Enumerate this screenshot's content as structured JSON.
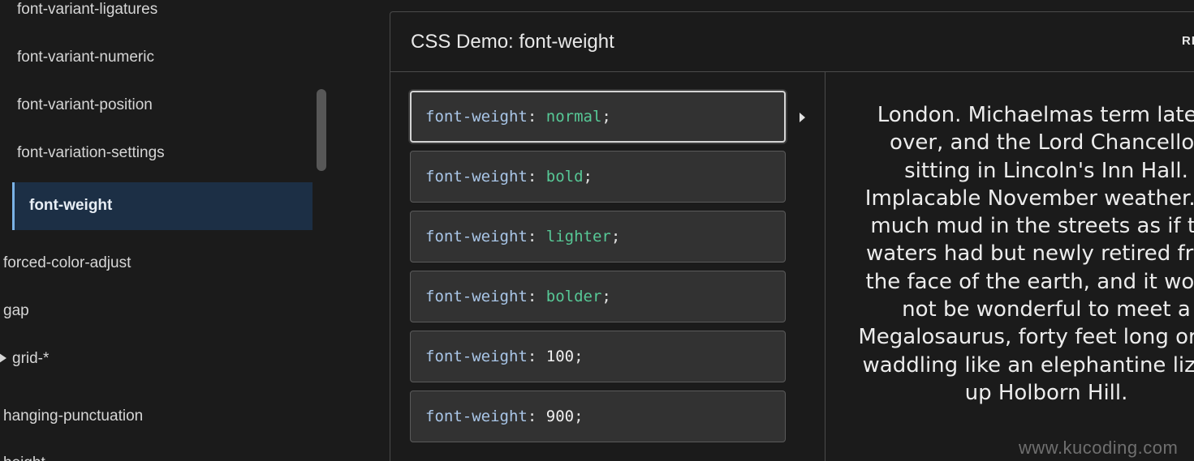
{
  "sidebar": {
    "items": [
      {
        "label": "font-variant-ligatures"
      },
      {
        "label": "font-variant-numeric"
      },
      {
        "label": "font-variant-position"
      },
      {
        "label": "font-variation-settings"
      },
      {
        "label": "font-weight"
      },
      {
        "label": "forced-color-adjust"
      },
      {
        "label": "gap"
      },
      {
        "label": "grid-*"
      },
      {
        "label": "hanging-punctuation"
      },
      {
        "label": "height"
      }
    ]
  },
  "demo": {
    "title": "CSS Demo: font-weight",
    "reset_label": "RESET",
    "options": [
      {
        "property": "font-weight",
        "colon": ":",
        "value": "normal",
        "semicolon": ";"
      },
      {
        "property": "font-weight",
        "colon": ":",
        "value": "bold",
        "semicolon": ";"
      },
      {
        "property": "font-weight",
        "colon": ":",
        "value": "lighter",
        "semicolon": ";"
      },
      {
        "property": "font-weight",
        "colon": ":",
        "value": "bolder",
        "semicolon": ";"
      },
      {
        "property": "font-weight",
        "colon": ":",
        "value": "100",
        "semicolon": ";"
      },
      {
        "property": "font-weight",
        "colon": ":",
        "value": "900",
        "semicolon": ";"
      }
    ],
    "output_lines": [
      "London. Michaelmas term lately",
      "over, and the Lord Chancellor",
      "sitting in Lincoln's Inn Hall.",
      "Implacable November weather. As",
      "much mud in the streets as if the",
      "waters had but newly retired from",
      "the face of the earth, and it would",
      "not be wonderful to meet a",
      "Megalosaurus, forty feet long or so,",
      "waddling like an elephantine lizard",
      "up Holborn Hill."
    ]
  },
  "watermark": "www.kucoding.com",
  "colors": {
    "background": "#1b1b1b",
    "active_bg": "#1c2f45",
    "active_border": "#7ab2e6",
    "keyword": "#57c896",
    "property": "#a9c6e8"
  }
}
